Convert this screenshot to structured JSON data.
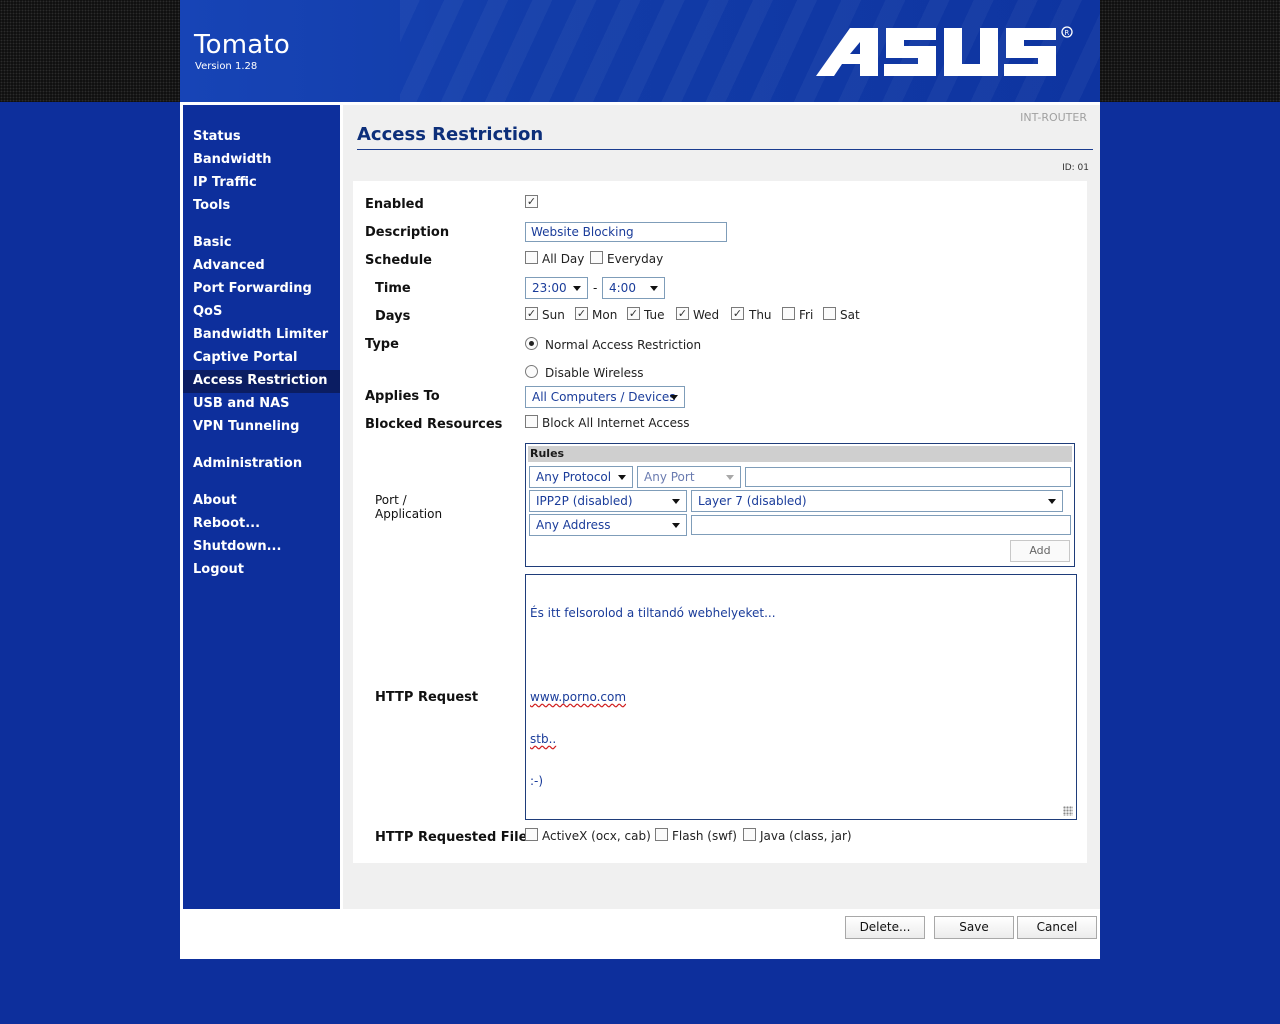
{
  "header": {
    "title": "Tomato",
    "version": "Version 1.28",
    "logo_name": "ASUS",
    "logo_color": "#ffffff"
  },
  "sidebar": {
    "groups": [
      [
        "Status",
        "Bandwidth",
        "IP Traffic",
        "Tools"
      ],
      [
        "Basic",
        "Advanced",
        "Port Forwarding",
        "QoS",
        "Bandwidth Limiter",
        "Captive Portal",
        "Access Restriction",
        "USB and NAS",
        "VPN Tunneling"
      ],
      [
        "Administration"
      ],
      [
        "About",
        "Reboot...",
        "Shutdown...",
        "Logout"
      ]
    ],
    "active": "Access Restriction"
  },
  "page": {
    "router_name": "INT-ROUTER",
    "title": "Access Restriction",
    "id_label": "ID: 01"
  },
  "form": {
    "enabled": {
      "label": "Enabled",
      "checked": true
    },
    "description": {
      "label": "Description",
      "value": "Website Blocking"
    },
    "schedule": {
      "label": "Schedule",
      "all_day": {
        "label": "All Day",
        "checked": false
      },
      "everyday": {
        "label": "Everyday",
        "checked": false
      }
    },
    "time": {
      "label": "Time",
      "from": "23:00",
      "separator": "-",
      "to": "4:00"
    },
    "days": {
      "label": "Days",
      "items": [
        {
          "label": "Sun",
          "checked": true
        },
        {
          "label": "Mon",
          "checked": true
        },
        {
          "label": "Tue",
          "checked": true
        },
        {
          "label": "Wed",
          "checked": true
        },
        {
          "label": "Thu",
          "checked": true
        },
        {
          "label": "Fri",
          "checked": false
        },
        {
          "label": "Sat",
          "checked": false
        }
      ]
    },
    "type": {
      "label": "Type",
      "normal": "Normal Access Restriction",
      "disable_wireless": "Disable Wireless",
      "selected": "normal"
    },
    "applies_to": {
      "label": "Applies To",
      "value": "All Computers / Devices"
    },
    "blocked_resources": {
      "label": "Blocked Resources",
      "block_all": {
        "label": "Block All Internet Access",
        "checked": false
      }
    },
    "port_application": {
      "label_line1": "Port /",
      "label_line2": "Application",
      "rules_header": "Rules",
      "protocol": "Any Protocol",
      "port": "Any Port",
      "port_value": "",
      "ipp2p": "IPP2P (disabled)",
      "layer7": "Layer 7 (disabled)",
      "address": "Any Address",
      "address_value": "",
      "add_label": "Add"
    },
    "http_request": {
      "label": "HTTP Request",
      "line1": "És itt felsorolod a tiltandó webhelyeket...",
      "line2": "",
      "line3": "www.porno.com",
      "line4": "stb..",
      "line5": ":-)"
    },
    "http_files": {
      "label": "HTTP Requested Files",
      "activex": {
        "label": "ActiveX (ocx, cab)",
        "checked": false
      },
      "flash": {
        "label": "Flash (swf)",
        "checked": false
      },
      "java": {
        "label": "Java (class, jar)",
        "checked": false
      }
    }
  },
  "footer": {
    "delete": "Delete...",
    "save": "Save",
    "cancel": "Cancel"
  },
  "colors": {
    "background_blue": "#0d2f9c",
    "active_nav": "#0b1d62",
    "title_blue": "#0d2f7a",
    "field_text": "#1a3c9a"
  }
}
